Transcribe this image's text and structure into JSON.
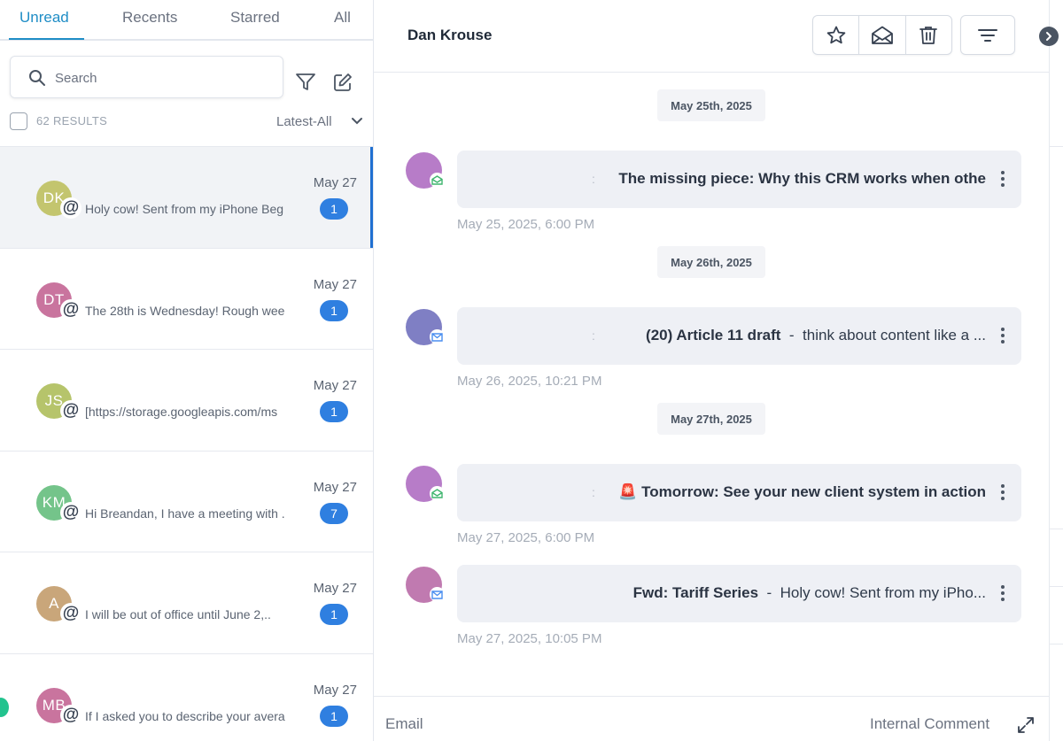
{
  "tabs": [
    {
      "label": "Unread",
      "active": true
    },
    {
      "label": "Recents",
      "active": false
    },
    {
      "label": "Starred",
      "active": false
    },
    {
      "label": "All",
      "active": false
    }
  ],
  "search": {
    "placeholder": "Search",
    "value": ""
  },
  "list_controls": {
    "results_label": "62 RESULTS",
    "sort_label": "Latest-All"
  },
  "conversations": [
    {
      "initials": "DK",
      "avatar_color": "#c3c56e",
      "snippet": "Holy cow! Sent from my iPhone Beg",
      "date": "May 27",
      "count": "1",
      "active": true
    },
    {
      "initials": "DT",
      "avatar_color": "#c9749e",
      "snippet": "The 28th is Wednesday!  Rough wee",
      "date": "May 27",
      "count": "1",
      "active": false
    },
    {
      "initials": "JS",
      "avatar_color": "#b6c46b",
      "snippet": "[https://storage.googleapis.com/ms",
      "date": "May 27",
      "count": "1",
      "active": false
    },
    {
      "initials": "KM",
      "avatar_color": "#74c48a",
      "snippet": "Hi Breandan, I have a meeting with .",
      "date": "May 27",
      "count": "7",
      "active": false
    },
    {
      "initials": "A",
      "avatar_color": "#c9a67a",
      "snippet": "I will be out of office until June 2,..",
      "date": "May 27",
      "count": "1",
      "active": false
    },
    {
      "initials": "MB",
      "avatar_color": "#c9749e",
      "snippet": "If I asked you to describe your avera",
      "date": "May 27",
      "count": "1",
      "active": false
    }
  ],
  "header": {
    "contact_name": "Dan Krouse"
  },
  "date_separators": [
    "May 25th, 2025",
    "May 26th, 2025",
    "May 27th, 2025"
  ],
  "messages": [
    {
      "avatar_color": "#b77cc8",
      "channel": "email-opened",
      "channel_color": "#3fb56f",
      "subject": "The missing piece: Why this CRM works when othe",
      "preview": "",
      "timestamp": "May 25, 2025, 6:00 PM"
    },
    {
      "avatar_color": "#7f7fc4",
      "channel": "email",
      "channel_color": "#4a8ef0",
      "subject": "(20)  Article 11 draft",
      "preview": "think about content like a ...",
      "timestamp": "May 26, 2025, 10:21 PM"
    },
    {
      "avatar_color": "#b77cc8",
      "channel": "email-opened",
      "channel_color": "#3fb56f",
      "subject": "Tomorrow: See your new client system in action",
      "preview": "",
      "emoji": "🚨",
      "timestamp": "May 27, 2025, 6:00 PM"
    },
    {
      "avatar_color": "#c07ab0",
      "channel": "email",
      "channel_color": "#4a8ef0",
      "subject": "Fwd: Tariff Series",
      "preview": "Holy cow! Sent from my iPho...",
      "timestamp": "May 27, 2025, 10:05 PM"
    }
  ],
  "composer": {
    "email_tab": "Email",
    "internal_tab": "Internal Comment"
  },
  "colors": {
    "accent": "#1f8dc6",
    "badge": "#2f7fe0",
    "active_bar": "#1f6fd1"
  }
}
